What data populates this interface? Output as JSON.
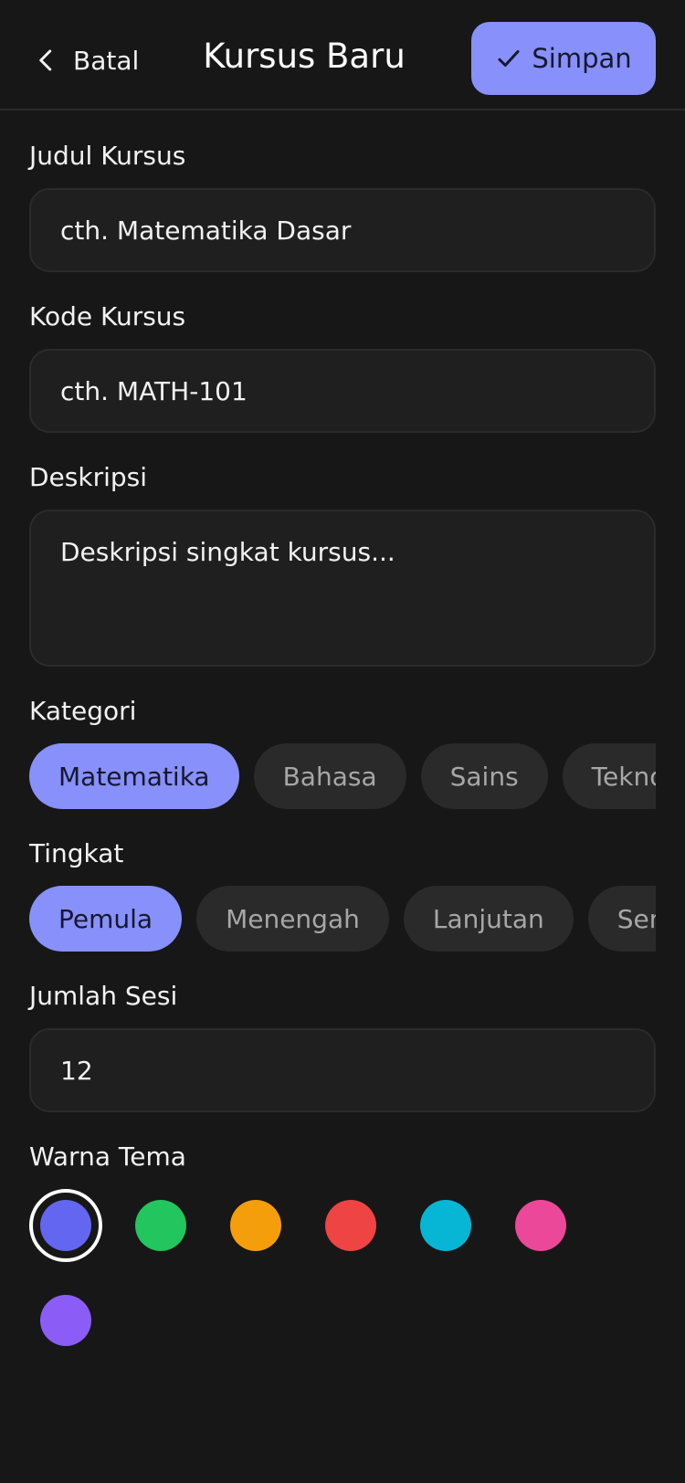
{
  "header": {
    "back_label": "Batal",
    "title": "Kursus Baru",
    "save_label": "Simpan"
  },
  "form": {
    "title": {
      "label": "Judul Kursus",
      "placeholder": "cth. Matematika Dasar"
    },
    "code": {
      "label": "Kode Kursus",
      "placeholder": "cth. MATH-101"
    },
    "description": {
      "label": "Deskripsi",
      "placeholder": "Deskripsi singkat kursus..."
    },
    "category": {
      "label": "Kategori",
      "options": [
        "Matematika",
        "Bahasa",
        "Sains",
        "Teknologi"
      ],
      "selected": "Matematika"
    },
    "level": {
      "label": "Tingkat",
      "options": [
        "Pemula",
        "Menengah",
        "Lanjutan",
        "Semua"
      ],
      "selected": "Pemula"
    },
    "sessions": {
      "label": "Jumlah Sesi",
      "value": "12"
    },
    "theme": {
      "label": "Warna Tema",
      "colors": [
        "#6366f1",
        "#22c55e",
        "#f59e0b",
        "#ef4444",
        "#06b6d4",
        "#ec4899",
        "#8b5cf6"
      ],
      "selected": "#6366f1"
    }
  },
  "icons": {
    "back": "chevron-left-icon",
    "save": "check-icon"
  },
  "colors": {
    "accent": "#8790fb",
    "background": "#171717",
    "surface": "#1f1f1f",
    "chip": "#2a2a2a"
  }
}
